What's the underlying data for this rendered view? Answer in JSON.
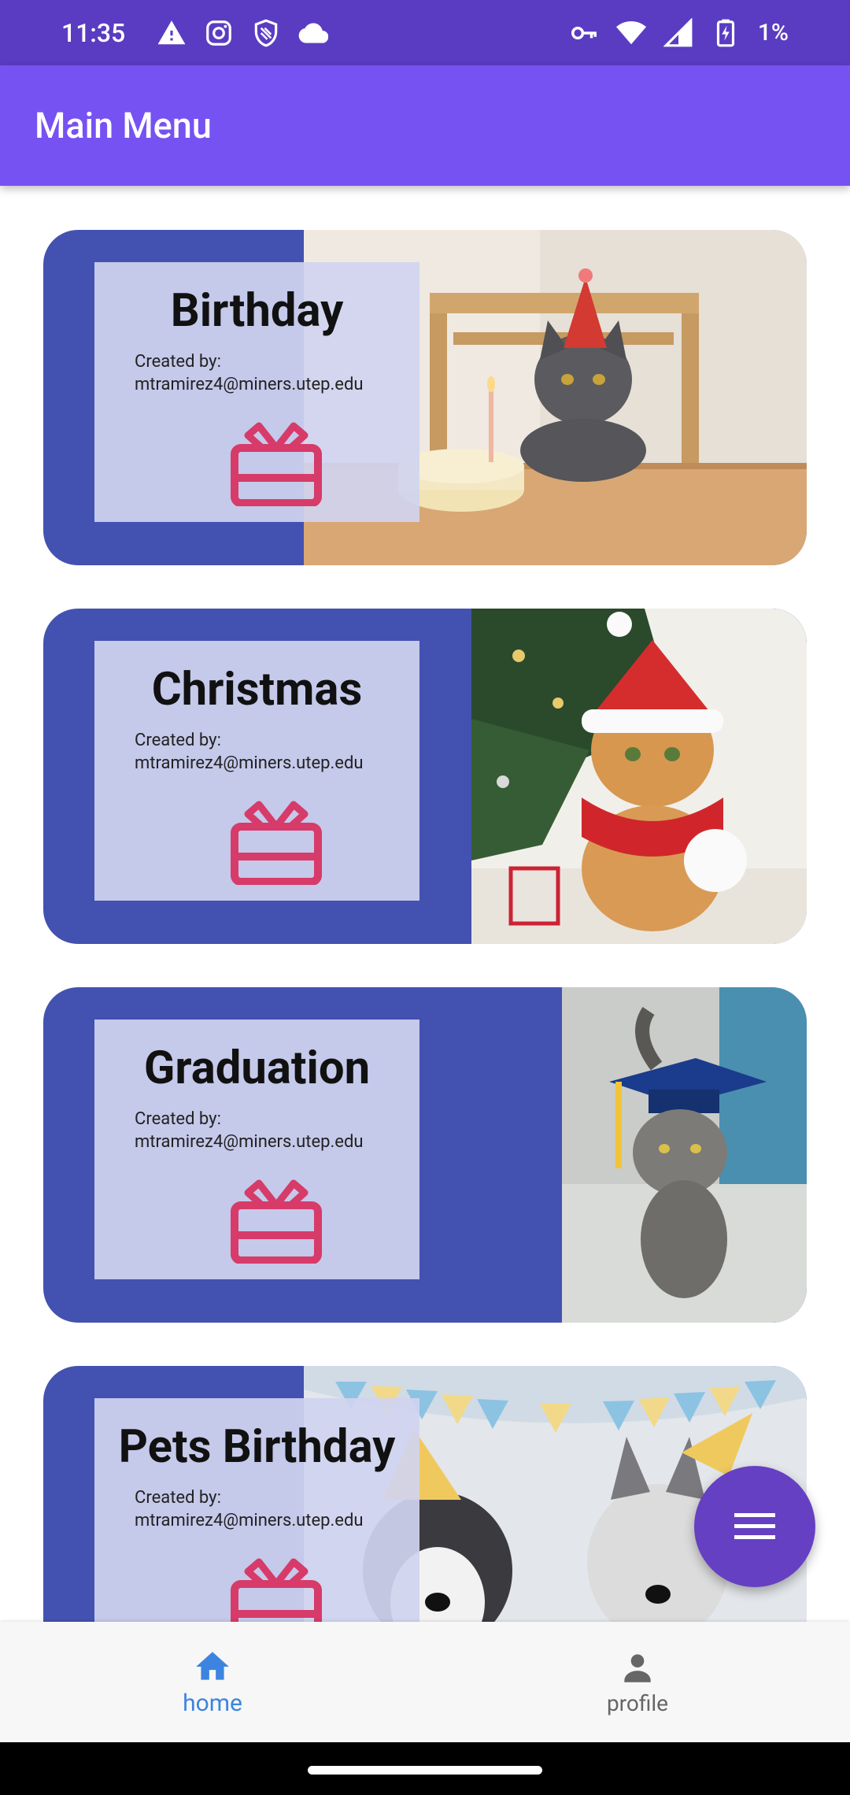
{
  "status_bar": {
    "time": "11:35",
    "battery_text": "1%",
    "left_icons": [
      "warning-icon",
      "instagram-icon",
      "shield-icon",
      "cloud-icon"
    ],
    "right_icons": [
      "vpn-key-icon",
      "wifi-icon",
      "signal-icon",
      "battery-charging-icon"
    ]
  },
  "app_bar": {
    "title": "Main Menu"
  },
  "cards": [
    {
      "title": "Birthday",
      "created_by_label": "Created by:",
      "creator": "mtramirez4@miners.utep.edu",
      "icon": "gift-icon",
      "photo": "birthday-cat-photo"
    },
    {
      "title": "Christmas",
      "created_by_label": "Created by:",
      "creator": "mtramirez4@miners.utep.edu",
      "icon": "gift-icon",
      "photo": "christmas-cat-photo"
    },
    {
      "title": "Graduation",
      "created_by_label": "Created by:",
      "creator": "mtramirez4@miners.utep.edu",
      "icon": "gift-icon",
      "photo": "graduation-cat-photo"
    },
    {
      "title": "Pets Birthday",
      "created_by_label": "Created by:",
      "creator": "mtramirez4@miners.utep.edu",
      "icon": "gift-icon",
      "photo": "pets-birthday-dogs-photo"
    }
  ],
  "fab": {
    "icon": "menu-icon"
  },
  "bottom_nav": {
    "items": [
      {
        "label": "home",
        "icon": "home-icon",
        "active": true
      },
      {
        "label": "profile",
        "icon": "person-icon",
        "active": false
      }
    ]
  },
  "colors": {
    "status_bar": "#5a3cc2",
    "app_bar": "#7652f2",
    "card_bg": "#4351b1",
    "panel_bg": "#d0d4ef",
    "gift_icon": "#d63b6a",
    "fab": "#6540c2",
    "nav_active": "#3c84e0"
  }
}
